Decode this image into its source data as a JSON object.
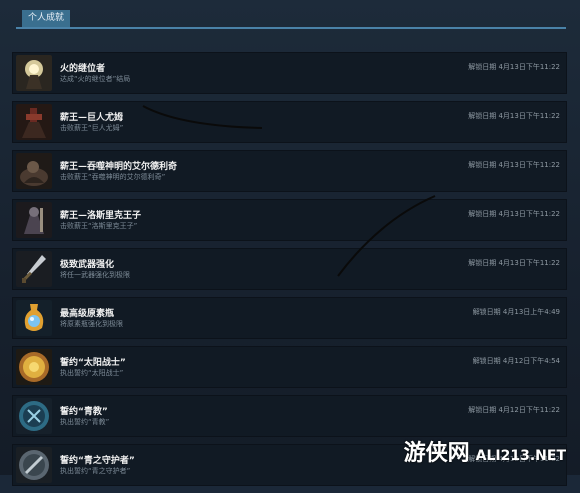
{
  "tab_label": "个人成就",
  "achievements": [
    {
      "title": "火的继位者",
      "desc": "达成“火的继位者”结局",
      "date": "解锁日期 4月13日下午11:22",
      "icon": "fire-successor-icon"
    },
    {
      "title": "薪王—巨人尤姆",
      "desc": "击败薪王“巨人尤姆”",
      "date": "解锁日期 4月13日下午11:22",
      "icon": "yhorm-icon"
    },
    {
      "title": "薪王—吞噬神明的艾尔德利奇",
      "desc": "击败薪王“吞噬神明的艾尔德利奇”",
      "date": "解锁日期 4月13日下午11:22",
      "icon": "aldrich-icon"
    },
    {
      "title": "薪王—洛斯里克王子",
      "desc": "击败薪王“洛斯里克王子”",
      "date": "解锁日期 4月13日下午11:22",
      "icon": "lothric-icon"
    },
    {
      "title": "极致武器强化",
      "desc": "将任一武器强化到极限",
      "date": "解锁日期 4月13日下午11:22",
      "icon": "sword-icon"
    },
    {
      "title": "最高级原素瓶",
      "desc": "将原素瓶强化到极限",
      "date": "解锁日期 4月13日上午4:49",
      "icon": "estus-icon"
    },
    {
      "title": "誓约“太阳战士”",
      "desc": "执出誓约“太阳战士”",
      "date": "解锁日期 4月12日下午4:54",
      "icon": "sun-medal-icon"
    },
    {
      "title": "誓约“青教”",
      "desc": "执出誓约“青教”",
      "date": "解锁日期 4月12日下午11:22",
      "icon": "blue-medal-icon"
    },
    {
      "title": "誓约“青之守护者”",
      "desc": "执出誓约“青之守护者”",
      "date": "解锁日期 4月12日下午11:22",
      "icon": "blade-medal-icon"
    }
  ],
  "watermark": {
    "cn": "游侠网",
    "en": "ALI213.NET"
  }
}
